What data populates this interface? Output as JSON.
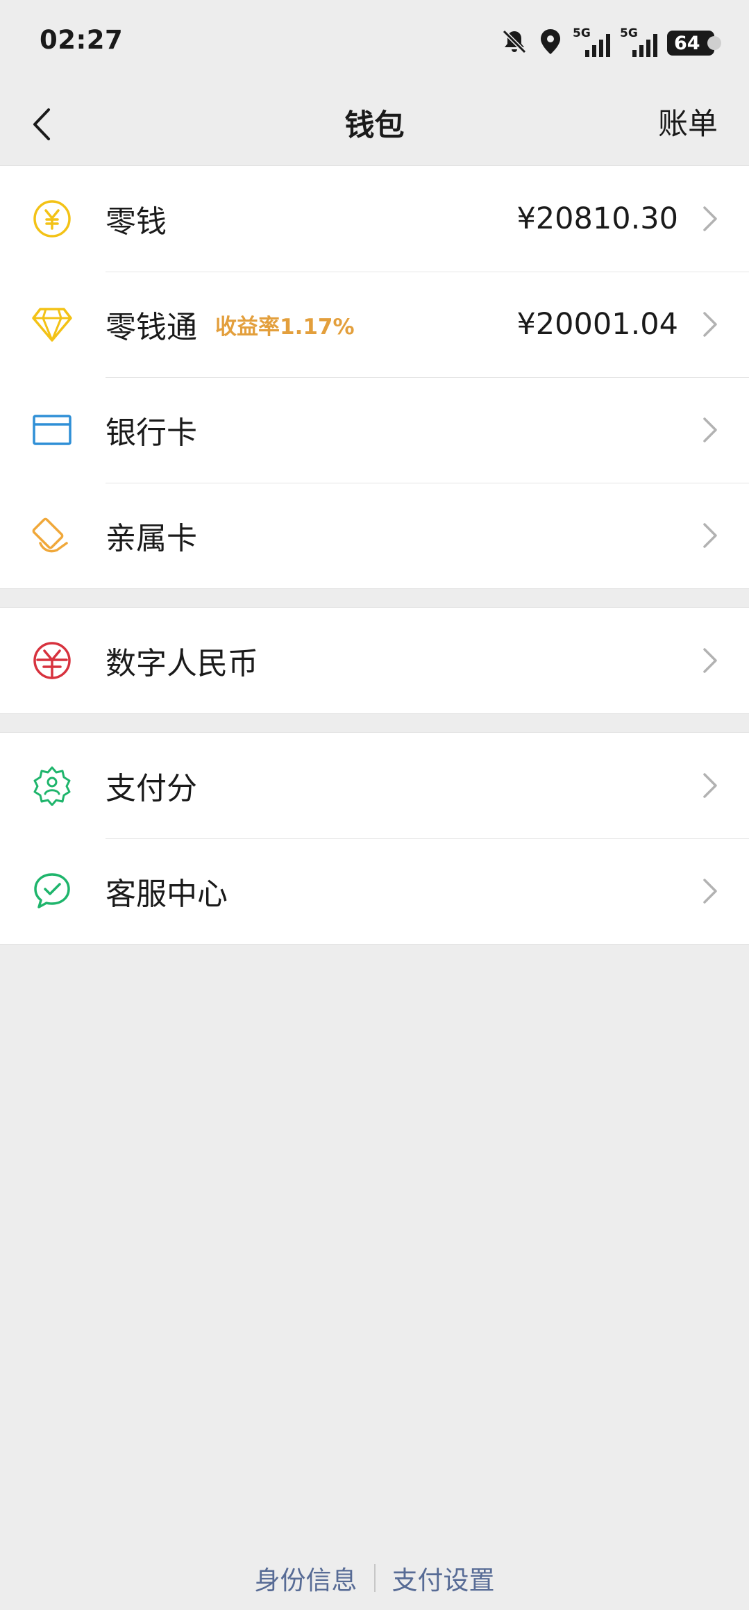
{
  "status_bar": {
    "time": "02:27",
    "signal1_label": "5G",
    "signal2_label": "5G",
    "battery": "64"
  },
  "nav": {
    "title": "钱包",
    "bill": "账单"
  },
  "items": [
    {
      "label": "零钱",
      "value": "¥20810.30",
      "icon": "yen-coin-icon"
    },
    {
      "label": "零钱通",
      "tag": "收益率1.17%",
      "value": "¥20001.04",
      "icon": "diamond-icon"
    },
    {
      "label": "银行卡",
      "icon": "bank-card-icon"
    },
    {
      "label": "亲属卡",
      "icon": "family-card-icon"
    },
    {
      "label": "数字人民币",
      "icon": "digital-rmb-icon"
    },
    {
      "label": "支付分",
      "icon": "pay-score-icon"
    },
    {
      "label": "客服中心",
      "icon": "customer-service-icon"
    }
  ],
  "footer": {
    "identity": "身份信息",
    "pay_settings": "支付设置"
  },
  "colors": {
    "background": "#ededed",
    "tag": "#e39f3c",
    "link": "#576b95",
    "yellow_icon": "#f3c216",
    "blue_icon": "#2f8fd6",
    "orange_icon": "#f0a83a",
    "red_icon": "#d7323e",
    "green_icon": "#1fb56c"
  }
}
